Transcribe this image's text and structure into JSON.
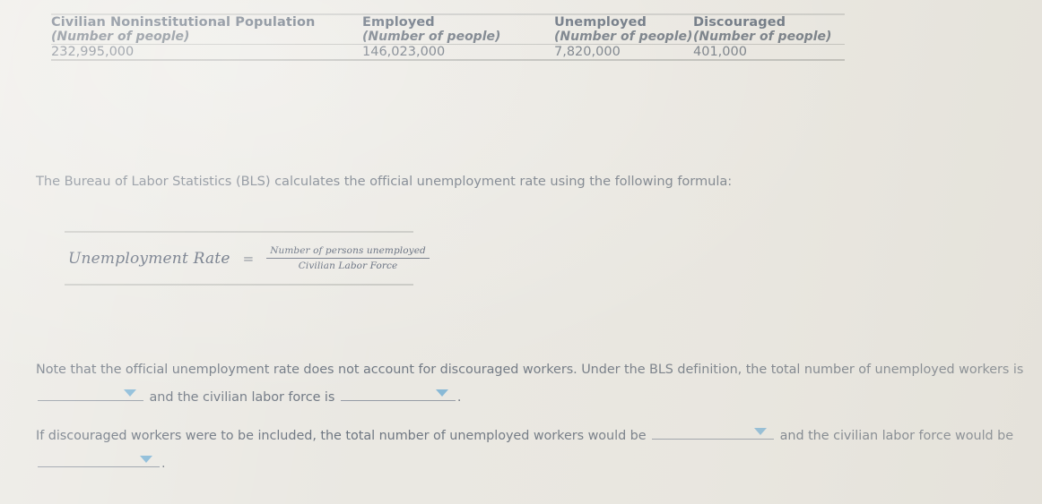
{
  "table": {
    "columns": [
      {
        "title": "Civilian Noninstitutional Population",
        "subtitle": "(Number of people)",
        "value": "232,995,000"
      },
      {
        "title": "Employed",
        "subtitle": "(Number of people)",
        "value": "146,023,000"
      },
      {
        "title": "Unemployed",
        "subtitle": "(Number of people)",
        "value": "7,820,000"
      },
      {
        "title": "Discouraged",
        "subtitle": "(Number of people)",
        "value": "401,000"
      }
    ]
  },
  "intro": {
    "text": "The Bureau of Labor Statistics (BLS) calculates the official unemployment rate using the following formula:"
  },
  "formula": {
    "lhs": "Unemployment Rate",
    "equals": "=",
    "numerator": "Number of persons unemployed",
    "denominator": "Civilian Labor Force"
  },
  "note": {
    "part1": "Note that the official unemployment rate does not account for discouraged workers. Under the BLS definition, the total number of unemployed workers is",
    "part2": "and the civilian labor force is",
    "period": "."
  },
  "question": {
    "part1": "If discouraged workers were to be included, the total number of unemployed workers would be",
    "part2": "and the civilian labor force would be",
    "period": "."
  },
  "icons": {
    "dropdown": "chevron-down-icon"
  },
  "colors": {
    "page_background": "#e9e7e1",
    "body_text": "#646d79",
    "header_text": "#4f5b6b",
    "dropdown_caret": "#7fb4d4",
    "rule": "#c3c3bd"
  }
}
